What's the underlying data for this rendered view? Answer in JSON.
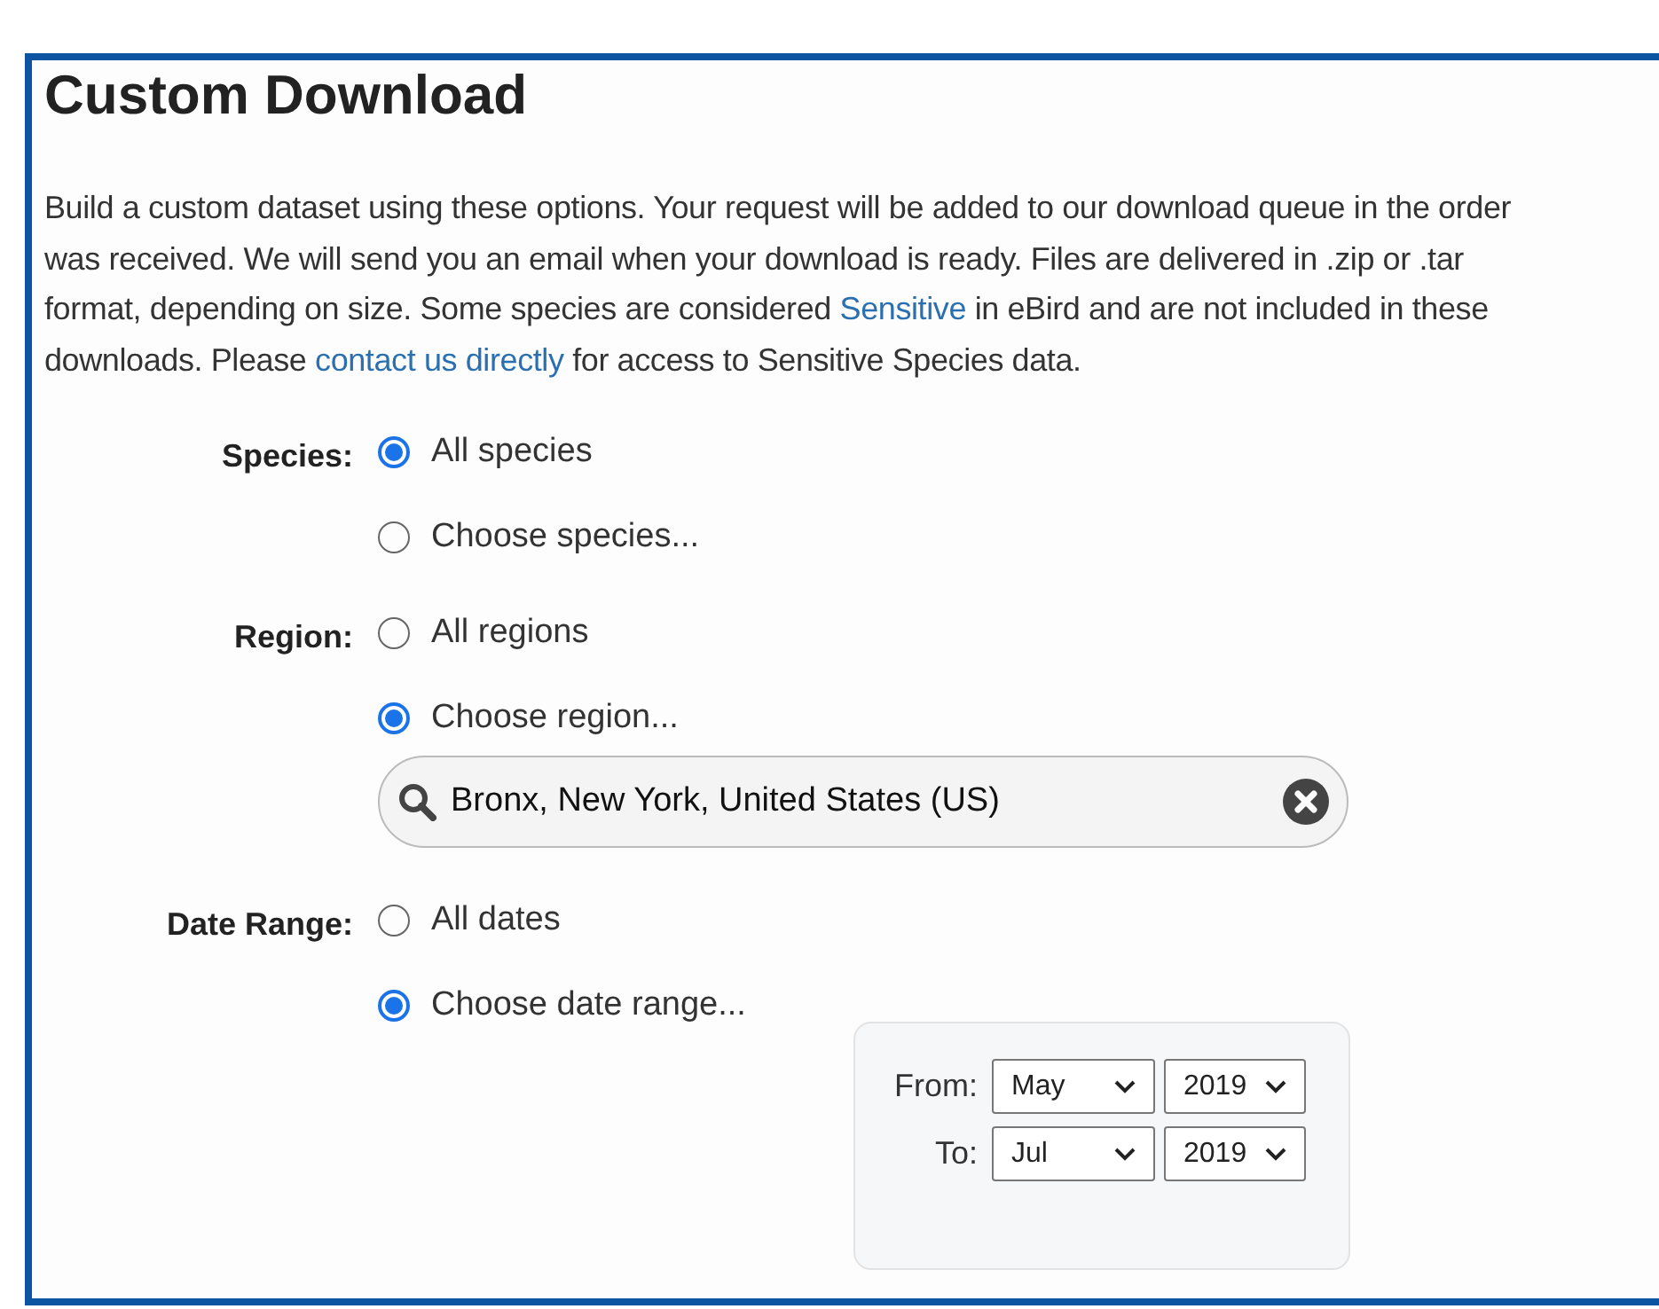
{
  "title": "Custom Download",
  "description": [
    [
      {
        "kind": "text",
        "text": "Build a custom dataset using these options. Your request will be added to our download queue in the order"
      }
    ],
    [
      {
        "kind": "text",
        "text": "was received. We will send you an email when your download is ready. Files are delivered in .zip or .tar"
      }
    ],
    [
      {
        "kind": "text",
        "text": "format, depending on size. Some species are considered "
      },
      {
        "kind": "link",
        "text": "Sensitive"
      },
      {
        "kind": "text",
        "text": " in eBird and are not included in these"
      }
    ],
    [
      {
        "kind": "text",
        "text": "downloads. Please "
      },
      {
        "kind": "link",
        "text": "contact us directly"
      },
      {
        "kind": "text",
        "text": " for access to Sensitive Species data."
      }
    ]
  ],
  "groups": [
    {
      "label": "Species:",
      "options": [
        {
          "label": "All species",
          "selected": true
        },
        {
          "label": "Choose species...",
          "selected": false
        }
      ]
    },
    {
      "label": "Region:",
      "options": [
        {
          "label": "All regions",
          "selected": false
        },
        {
          "label": "Choose region...",
          "selected": true
        }
      ],
      "search": {
        "value": "Bronx, New York, United States (US)"
      }
    },
    {
      "label": "Date Range:",
      "options": [
        {
          "label": "All dates",
          "selected": false
        },
        {
          "label": "Choose date range...",
          "selected": true
        }
      ],
      "dates": [
        {
          "label": "From:",
          "month": "May",
          "year": "2019"
        },
        {
          "label": "To:",
          "month": "Jul",
          "year": "2019"
        }
      ]
    }
  ]
}
